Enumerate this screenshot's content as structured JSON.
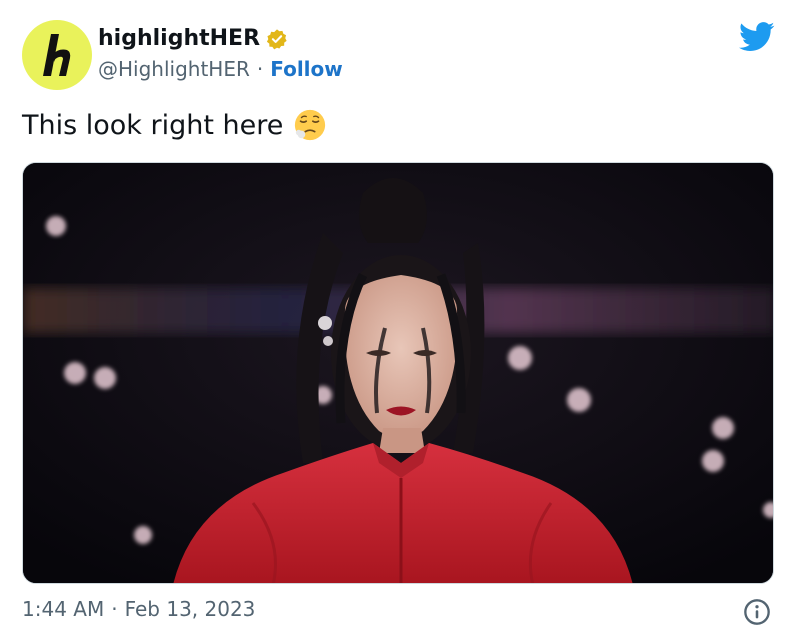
{
  "author": {
    "display_name": "highlightHER",
    "handle": "@HighlightHER",
    "separator": "·",
    "follow_label": "Follow",
    "avatar_letter": "h",
    "verified": true,
    "avatar_color": "#e9f25b",
    "verified_color": "#e2b719"
  },
  "tweet": {
    "text": "This look right here",
    "emoji": "relieved-face-with-exhale"
  },
  "media": {
    "type": "photo",
    "description_icon": "photo"
  },
  "footer": {
    "time": "1:44 AM",
    "separator": "·",
    "date": "Feb 13, 2023"
  },
  "colors": {
    "brand_blue": "#1d9bf0",
    "link_blue": "#1d74c9",
    "muted_text": "#536471"
  }
}
